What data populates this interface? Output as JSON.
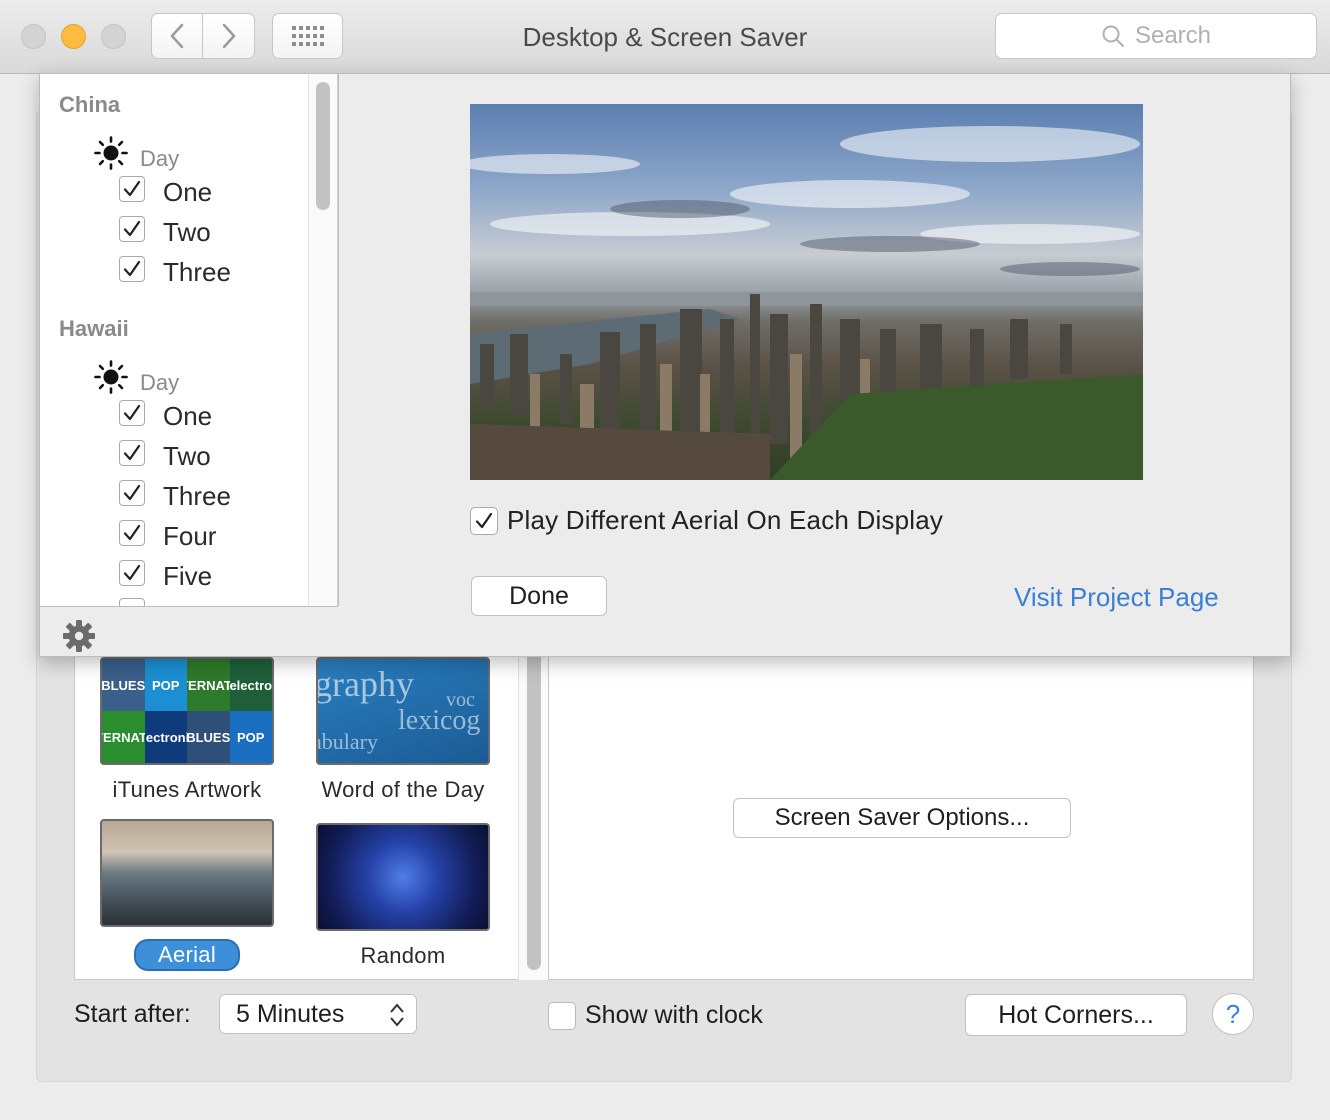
{
  "window": {
    "title": "Desktop & Screen Saver",
    "search_placeholder": "Search"
  },
  "sheet": {
    "regions": [
      {
        "name": "China",
        "day_label": "Day",
        "items": [
          {
            "label": "One",
            "checked": true
          },
          {
            "label": "Two",
            "checked": true
          },
          {
            "label": "Three",
            "checked": true
          }
        ]
      },
      {
        "name": "Hawaii",
        "day_label": "Day",
        "items": [
          {
            "label": "One",
            "checked": true
          },
          {
            "label": "Two",
            "checked": true
          },
          {
            "label": "Three",
            "checked": true
          },
          {
            "label": "Four",
            "checked": true
          },
          {
            "label": "Five",
            "checked": true
          }
        ]
      }
    ],
    "play_different_label": "Play Different Aerial On Each Display",
    "play_different_checked": true,
    "done_label": "Done",
    "visit_link": "Visit Project Page"
  },
  "screen_savers": [
    {
      "label": "iTunes Artwork",
      "selected": false
    },
    {
      "label": "Word of the Day",
      "selected": false
    },
    {
      "label": "Aerial",
      "selected": true
    },
    {
      "label": "Random",
      "selected": false
    }
  ],
  "itunes_tiles": [
    "BLUES",
    "POP",
    "ALTERNATIVE",
    "electro",
    "ALTERNATIVE",
    "electronic",
    "BLUES",
    "POP"
  ],
  "word_of_day_words": [
    "graphy",
    "voc",
    "lexicog",
    "abulary"
  ],
  "options_button": "Screen Saver Options...",
  "footer": {
    "start_after_label": "Start after:",
    "start_after_value": "5 Minutes",
    "show_clock_label": "Show with clock",
    "show_clock_checked": false,
    "hot_corners_label": "Hot Corners...",
    "help_label": "?"
  },
  "colors": {
    "accent": "#3d8fd9",
    "link": "#3b7fd4",
    "minimize_light": "#fdbc40"
  }
}
